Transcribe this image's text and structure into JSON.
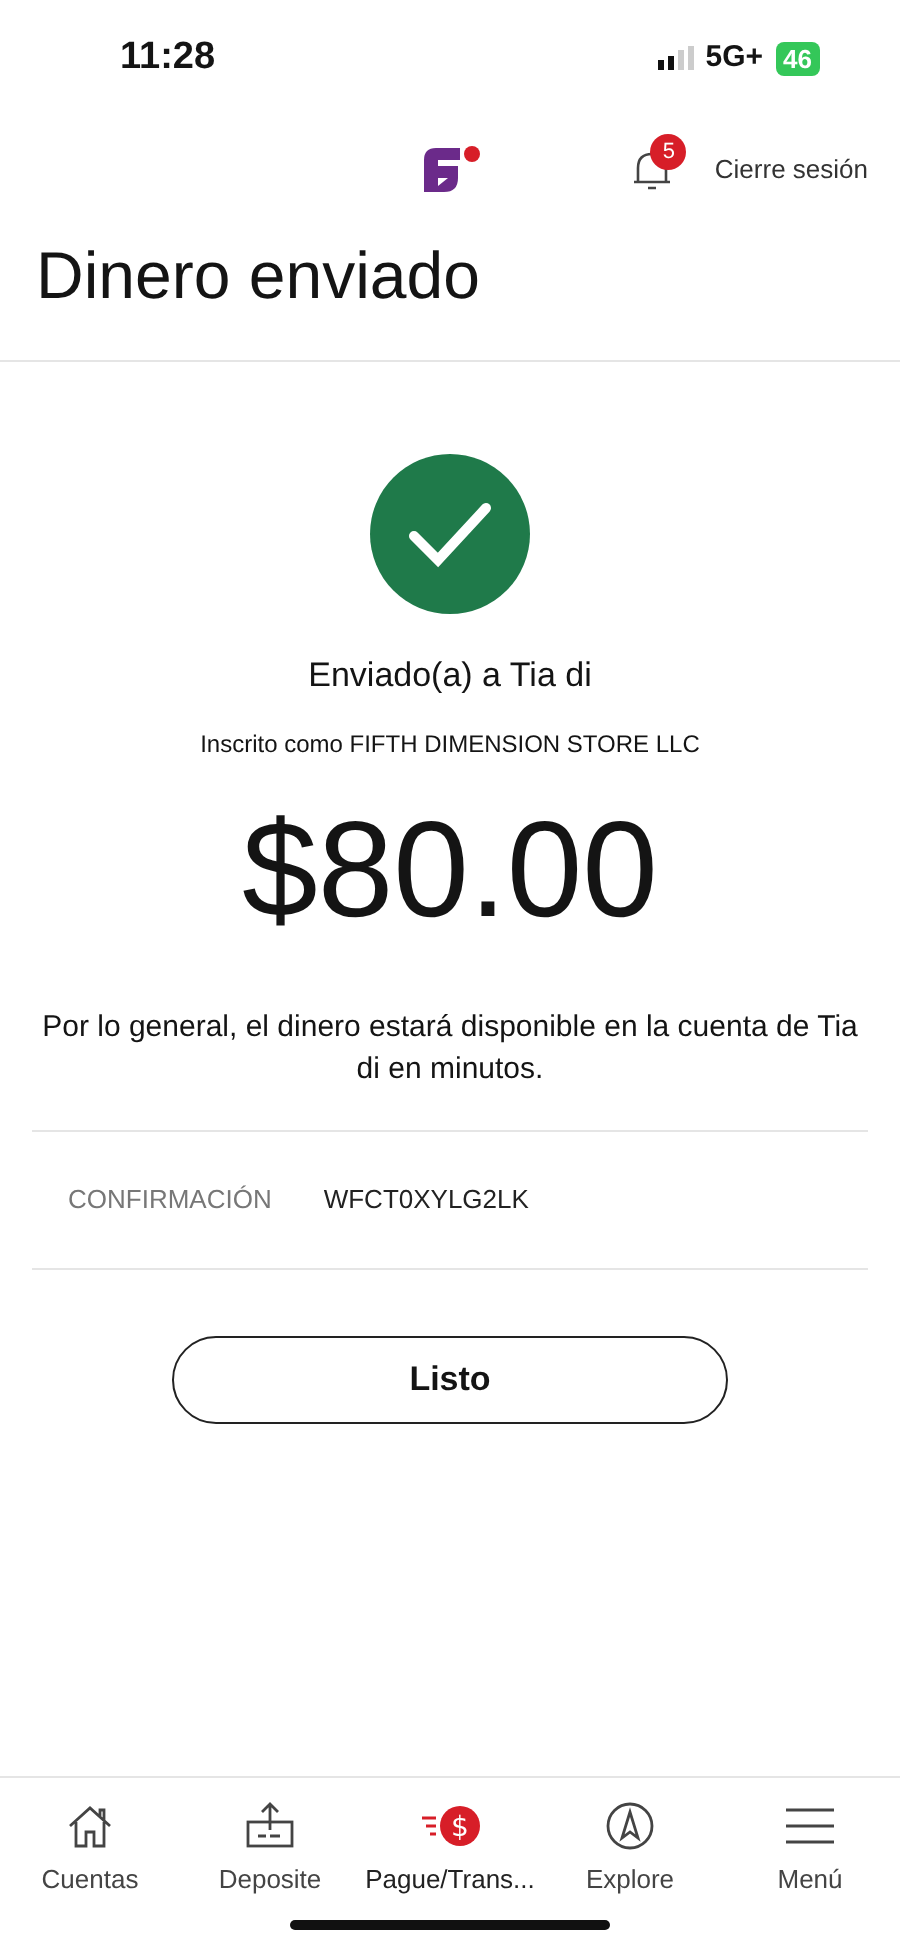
{
  "status_bar": {
    "time": "11:28",
    "network": "5G+",
    "battery": "46"
  },
  "header": {
    "notification_count": "5",
    "logout": "Cierre sesión"
  },
  "title": "Dinero enviado",
  "result": {
    "recipient": "Enviado(a) a Tia di",
    "enrolled_as": "Inscrito como FIFTH DIMENSION STORE LLC",
    "amount": "$80.00",
    "note": "Por lo general, el dinero estará disponible en la cuenta de Tia di en minutos."
  },
  "confirmation": {
    "label": "CONFIRMACIÓN",
    "value": "WFCT0XYLG2LK"
  },
  "done_button": "Listo",
  "nav": [
    {
      "kind": "home",
      "label": "Cuentas",
      "selected": false
    },
    {
      "kind": "deposit",
      "label": "Deposite",
      "selected": false
    },
    {
      "kind": "transfer",
      "label": "Pague/Trans...",
      "icon_glyph": "$",
      "selected": true
    },
    {
      "kind": "explore",
      "label": "Explore",
      "selected": false
    },
    {
      "kind": "menu",
      "label": "Menú",
      "selected": false
    }
  ]
}
